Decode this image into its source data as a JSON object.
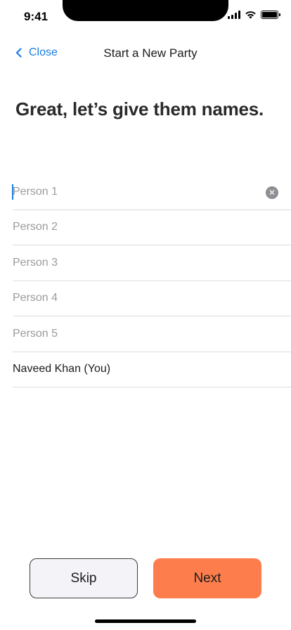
{
  "status_bar": {
    "time": "9:41"
  },
  "nav": {
    "close_label": "Close",
    "title": "Start a New Party"
  },
  "heading": "Great, let’s give them names.",
  "names": [
    {
      "placeholder": "Person 1",
      "value": ""
    },
    {
      "placeholder": "Person 2",
      "value": ""
    },
    {
      "placeholder": "Person 3",
      "value": ""
    },
    {
      "placeholder": "Person 4",
      "value": ""
    },
    {
      "placeholder": "Person 5",
      "value": ""
    }
  ],
  "self_name": "Naveed Khan (You)",
  "buttons": {
    "skip_label": "Skip",
    "next_label": "Next"
  },
  "colors": {
    "accent": "#1a7fe0",
    "primary_button": "#fd7e4c",
    "secondary_button": "#f3f3f8"
  },
  "icons": {
    "back": "chevron-left-icon",
    "clear": "clear-circle-icon"
  }
}
